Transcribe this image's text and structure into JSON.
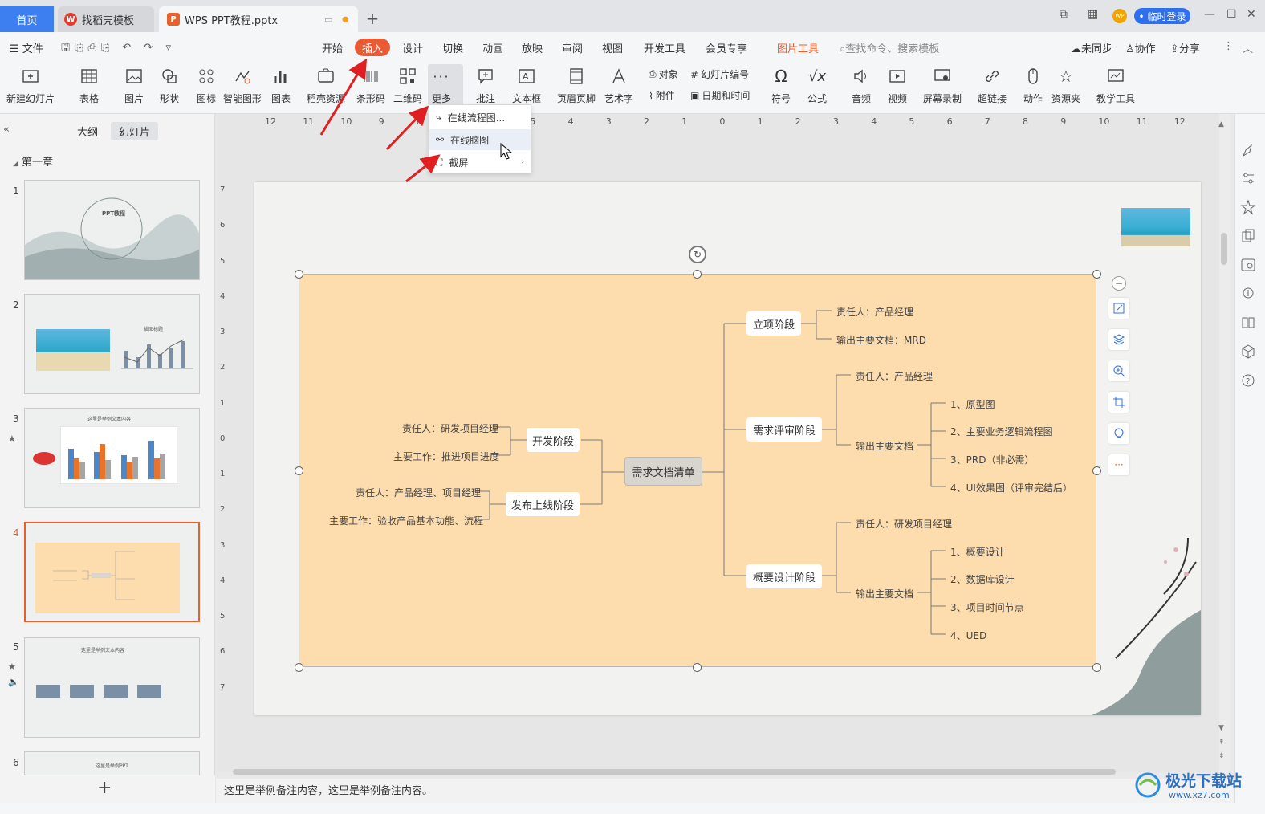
{
  "titlebar": {
    "tab_home": "首页",
    "tab_template": "找稻壳模板",
    "tab_doc": "WPS PPT教程.pptx",
    "login": "• 临时登录",
    "avatar": "WP"
  },
  "menubar": {
    "file": "文件",
    "items": [
      "开始",
      "插入",
      "设计",
      "切换",
      "动画",
      "放映",
      "审阅",
      "视图",
      "开发工具",
      "会员专享"
    ],
    "picture_tools": "图片工具",
    "search_placeholder": "查找命令、搜索模板",
    "unsync": "未同步",
    "collab": "协作",
    "share": "分享"
  },
  "ribbon": {
    "new_slide": "新建幻灯片",
    "table": "表格",
    "picture": "图片",
    "shape": "形状",
    "icon": "图标",
    "smartart": "智能图形",
    "chart": "图表",
    "resource": "稻壳资源",
    "barcode": "条形码",
    "qrcode": "二维码",
    "more": "更多",
    "comment": "批注",
    "textbox": "文本框",
    "header_footer": "页眉页脚",
    "wordart": "艺术字",
    "object": "对象",
    "slide_number": "幻灯片编号",
    "attachment": "附件",
    "datetime": "日期和时间",
    "symbol": "符号",
    "formula": "公式",
    "audio": "音频",
    "video": "视频",
    "screen_record": "屏幕录制",
    "hyperlink": "超链接",
    "action": "动作",
    "resource_folder": "资源夹",
    "teaching_tools": "教学工具"
  },
  "dropdown": {
    "flowchart": "在线流程图...",
    "mindmap": "在线脑图",
    "screenshot": "截屏"
  },
  "leftpanel": {
    "tab_outline": "大纲",
    "tab_slides": "幻灯片",
    "chapter": "第一章",
    "slide_numbers": [
      "1",
      "2",
      "3",
      "4",
      "5",
      "6"
    ],
    "thumb1_title": "PPT教程",
    "thumb2_title": "插图标题",
    "thumb3_title": "这里是举例文本内容",
    "thumb5_title": "这里是举例文本内容",
    "thumb6_title": "这里是举例PPT",
    "add": "+"
  },
  "mindmap": {
    "root": "需求文档清单",
    "left": [
      {
        "label": "开发阶段",
        "leaves": [
          "责任人：研发项目经理",
          "主要工作：推进项目进度"
        ]
      },
      {
        "label": "发布上线阶段",
        "leaves": [
          "责任人：产品经理、项目经理",
          "主要工作：验收产品基本功能、流程"
        ]
      }
    ],
    "right": [
      {
        "label": "立项阶段",
        "leaves": [
          "责任人：产品经理",
          "输出主要文档：MRD"
        ]
      },
      {
        "label": "需求评审阶段",
        "owner": "责任人：产品经理",
        "docs_label": "输出主要文档",
        "docs": [
          "1、原型图",
          "2、主要业务逻辑流程图",
          "3、PRD（非必需）",
          "4、UI效果图（评审完结后）"
        ]
      },
      {
        "label": "概要设计阶段",
        "owner": "责任人：研发项目经理",
        "docs_label": "输出主要文档",
        "docs": [
          "1、概要设计",
          "2、数据库设计",
          "3、项目时间节点",
          "4、UED"
        ]
      }
    ]
  },
  "hruler_labels": [
    "12",
    "11",
    "10",
    "9",
    "8",
    "7",
    "6",
    "5",
    "4",
    "3",
    "2",
    "1",
    "0",
    "1",
    "2",
    "3",
    "4",
    "5",
    "6",
    "7",
    "8",
    "9",
    "10",
    "11",
    "12"
  ],
  "vruler_labels": [
    "7",
    "6",
    "5",
    "4",
    "3",
    "2",
    "1",
    "0",
    "1",
    "2",
    "3",
    "4",
    "5",
    "6",
    "7"
  ],
  "notes": "这里是举例备注内容，这里是举例备注内容。",
  "watermark": {
    "name": "极光下载站",
    "url": "www.xz7.com"
  }
}
